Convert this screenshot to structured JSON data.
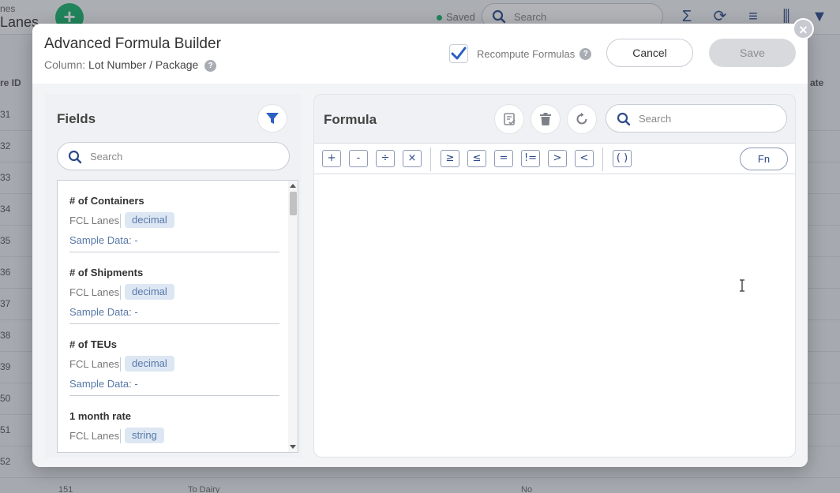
{
  "background": {
    "app_title_small": "nes",
    "app_title": "Lanes",
    "saved_label": "Saved",
    "search_placeholder": "Search",
    "grid_header_left": "re ID",
    "grid_header_right": "ate",
    "row_ids": [
      "31",
      "32",
      "33",
      "34",
      "35",
      "36",
      "37",
      "38",
      "39",
      "50",
      "51",
      "52"
    ],
    "bottom_row_id": "151",
    "bottom_row_text": "To Dairy",
    "bottom_row_value": "No"
  },
  "modal": {
    "title": "Advanced Formula Builder",
    "column_label": "Column:",
    "column_value": "Lot Number / Package",
    "help_glyph": "?",
    "recompute_label": "Recompute Formulas",
    "recompute_checked": true,
    "cancel_label": "Cancel",
    "save_label": "Save",
    "close_glyph": "×"
  },
  "fields_panel": {
    "title": "Fields",
    "search_placeholder": "Search",
    "items": [
      {
        "name": "# of Containers",
        "source": "FCL Lanes",
        "type": "decimal",
        "sample": "Sample Data: -"
      },
      {
        "name": "# of Shipments",
        "source": "FCL Lanes",
        "type": "decimal",
        "sample": "Sample Data: -"
      },
      {
        "name": "# of TEUs",
        "source": "FCL Lanes",
        "type": "decimal",
        "sample": "Sample Data: -"
      },
      {
        "name": "1 month rate",
        "source": "FCL Lanes",
        "type": "string",
        "sample": ""
      }
    ]
  },
  "formula_panel": {
    "title": "Formula",
    "search_placeholder": "Search",
    "operators": [
      "+",
      "-",
      "÷",
      "×",
      "≥",
      "≤",
      "=",
      "!=",
      ">",
      "<",
      "( )"
    ],
    "fn_label": "Fn"
  },
  "colors": {
    "accent": "#2d4a8a",
    "add_green": "#18b36b",
    "type_badge_bg": "#dde7f3",
    "type_badge_text": "#5878a8"
  }
}
